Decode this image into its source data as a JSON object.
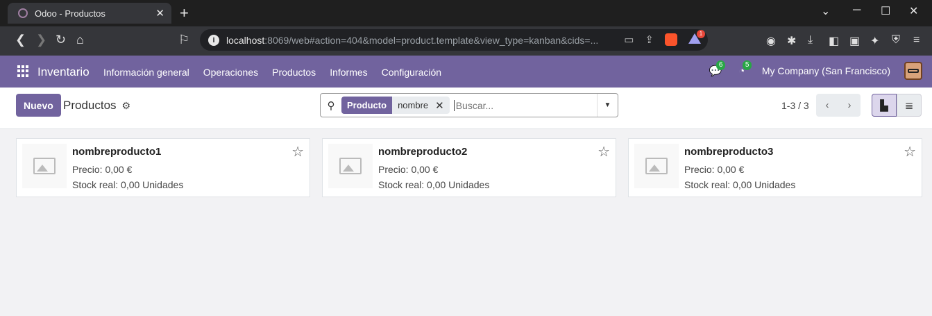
{
  "browser": {
    "tab_title": "Odoo - Productos",
    "url_host": "localhost",
    "url_rest": ":8069/web#action=404&model=product.template&view_type=kanban&cids=...",
    "rewards_badge": "1"
  },
  "navbar": {
    "brand": "Inventario",
    "menu": [
      "Información general",
      "Operaciones",
      "Productos",
      "Informes",
      "Configuración"
    ],
    "messages_count": "6",
    "activities_count": "5",
    "company": "My Company (San Francisco)"
  },
  "control": {
    "new_label": "Nuevo",
    "breadcrumb": "Productos",
    "facet_label": "Producto",
    "facet_value": "nombre",
    "search_placeholder": "Buscar...",
    "pager": "1-3 / 3"
  },
  "products": [
    {
      "name": "nombreproducto1",
      "price": "Precio: 0,00 €",
      "stock": "Stock real: 0,00 Unidades"
    },
    {
      "name": "nombreproducto2",
      "price": "Precio: 0,00 €",
      "stock": "Stock real: 0,00 Unidades"
    },
    {
      "name": "nombreproducto3",
      "price": "Precio: 0,00 €",
      "stock": "Stock real: 0,00 Unidades"
    }
  ],
  "colors": {
    "brand": "#71639e",
    "badge": "#28a745"
  }
}
